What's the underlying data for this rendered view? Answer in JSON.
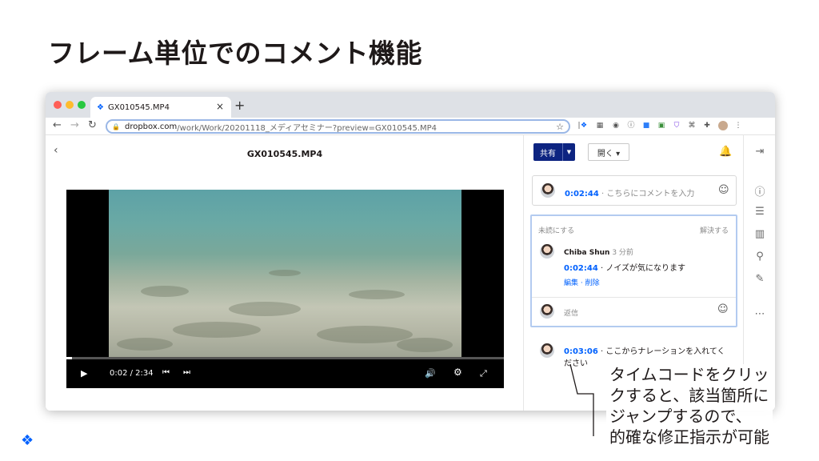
{
  "slide": {
    "title": "フレーム単位でのコメント機能",
    "annotation_lines": [
      "タイムコードをクリッ",
      "クすると、該当箇所に",
      "ジャンプするので、",
      "的確な修正指示が可能"
    ]
  },
  "browser": {
    "tab_title": "GX010545.MP4",
    "tab_close": "×",
    "new_tab": "+",
    "url_host": "dropbox.com",
    "url_path": "/work/Work/20201118_メディアセミナー?preview=GX010545.MP4",
    "traffic_colors": [
      "#fe5f57",
      "#febc2e",
      "#28c840"
    ]
  },
  "viewer": {
    "back": "‹",
    "filename": "GX010545.MP4",
    "time": "0:02 / 2:34",
    "progress": 0.013
  },
  "sidebar": {
    "share_label": "共有",
    "open_label": "開く ▾",
    "input_timecode": "0:02:44",
    "input_placeholder": "· こちらにコメントを入力",
    "thread": {
      "mark_unread": "未読にする",
      "resolve": "解決する",
      "author": "Chiba Shun",
      "when": "3 分前",
      "timecode": "0:02:44",
      "text": "· ノイズが気になります",
      "edit": "編集",
      "sep": "·",
      "delete": "削除",
      "reply_placeholder": "返信"
    },
    "comment2": {
      "timecode": "0:03:06",
      "text_line1": "· ここからナレーションを入れてく",
      "text_line2": "ださい"
    }
  },
  "colors": {
    "accent": "#0061fe",
    "share_button": "#0d2481",
    "thread_border": "#b3cbf0"
  }
}
